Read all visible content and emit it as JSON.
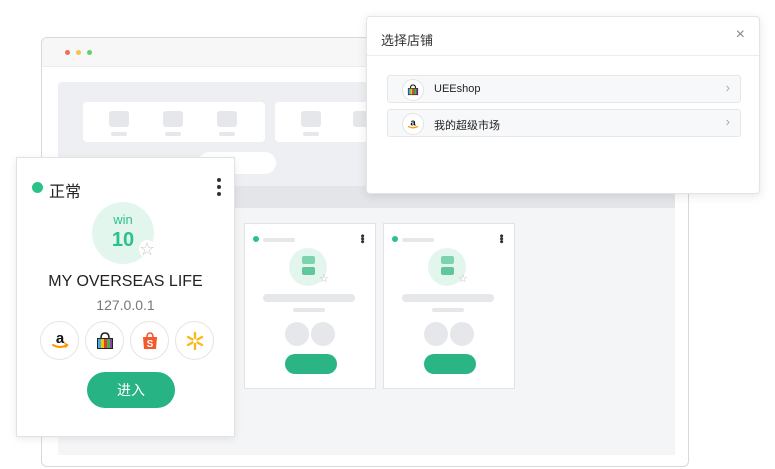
{
  "profile": {
    "status": "正常",
    "os_name": "win",
    "os_version": "10",
    "name": "MY OVERSEAS LIFE",
    "ip": "127.0.0.1",
    "enter_label": "进入",
    "platform_icons": [
      "amazon-icon",
      "ueeshop-icon",
      "shopee-icon",
      "walmart-icon"
    ]
  },
  "modal": {
    "title": "选择店铺",
    "close": "×",
    "stores": [
      {
        "name": "UEEshop",
        "icon": "ueeshop-icon"
      },
      {
        "name": "我的超级市场",
        "icon": "amazon-icon"
      }
    ],
    "chevron": "›"
  },
  "colors": {
    "accent_green": "#27b383",
    "status_green": "#2bc28a",
    "os_bg": "#e3f6ee",
    "shopee_orange": "#f4592e",
    "walmart_yellow": "#f9b918",
    "amazon_orange": "#ff9900"
  }
}
